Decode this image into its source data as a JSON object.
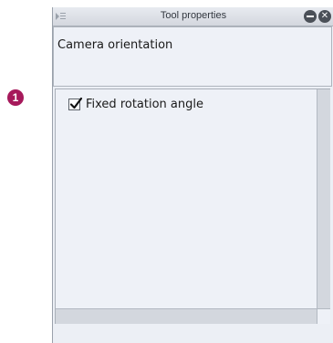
{
  "callout": {
    "number": "1"
  },
  "panel": {
    "title": "Tool properties",
    "icons": {
      "grip": "panel-grip-icon",
      "minimize": "minimize-icon",
      "close": "close-icon"
    },
    "section_label": "Camera orientation",
    "options": [
      {
        "label": "Fixed rotation angle",
        "checked": true
      }
    ]
  },
  "colors": {
    "panel_bg": "#eceff5",
    "title_bar": "#d3d7de",
    "callout": "#a6195b",
    "button": "#4b5058"
  }
}
